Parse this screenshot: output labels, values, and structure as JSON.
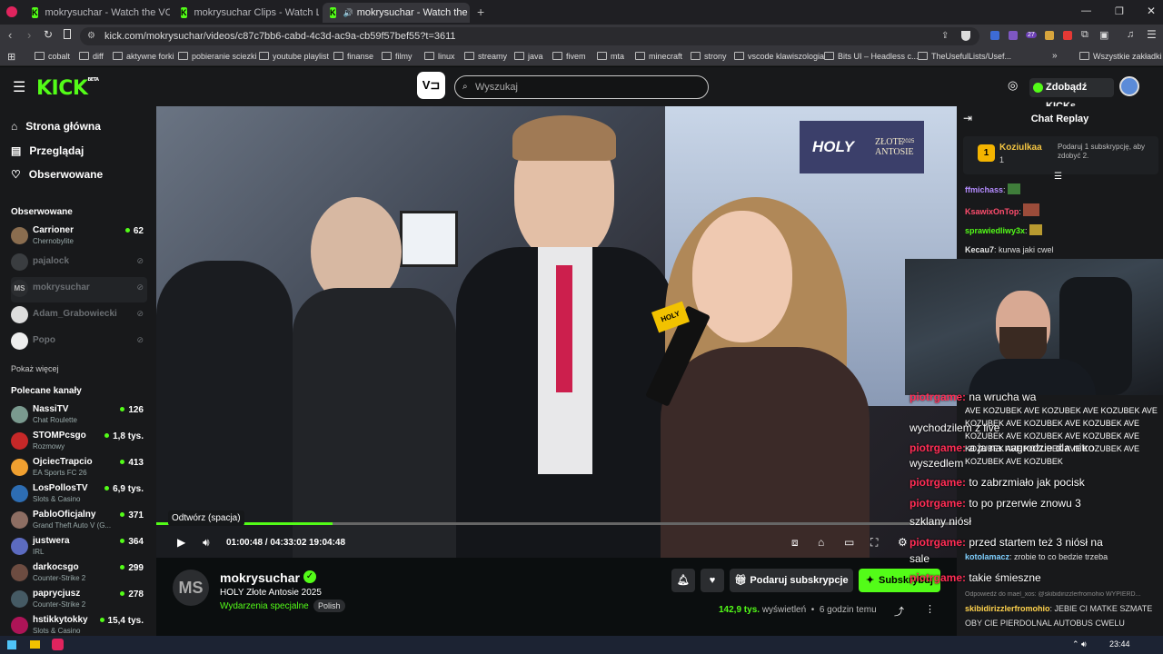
{
  "browser": {
    "tabs": [
      {
        "title": "mokrysuchar - Watch the VOD on Ki",
        "active": false
      },
      {
        "title": "mokrysuchar Clips - Watch Live on Ki",
        "active": false
      },
      {
        "title": "mokrysuchar - Watch the VO",
        "active": true
      }
    ],
    "url": "kick.com/mokrysuchar/videos/c87c7bb6-cabd-4c3d-ac9a-cb59f57bef55?t=3611",
    "ext_badge": "27",
    "bookmarks": [
      "cobalt",
      "diff",
      "aktywne forki",
      "pobieranie sciezki",
      "youtube playlist",
      "finanse",
      "filmy",
      "linux",
      "streamy",
      "java",
      "fivem",
      "mta",
      "minecraft",
      "strony",
      "vscode klawiszologia",
      "Bits UI – Headless c...",
      "TheUsefulLists/Usef..."
    ],
    "bookmarks_all": "Wszystkie zakładki"
  },
  "header": {
    "logo": "KICK",
    "logo_badge": "BETA",
    "search_placeholder": "Wyszukaj",
    "get_kicks": "Zdobądź KICKs"
  },
  "sidebar": {
    "nav": [
      "Strona główna",
      "Przeglądaj",
      "Obserwowane"
    ],
    "followed_title": "Obserwowane",
    "followed": [
      {
        "name": "Carrioner",
        "category": "Chernobylite",
        "count": "62",
        "online": true
      },
      {
        "name": "pajalock",
        "online": false
      },
      {
        "name": "mokrysuchar",
        "online": false,
        "selected": true,
        "initials": "MS"
      },
      {
        "name": "Adam_Grabowiecki",
        "online": false
      },
      {
        "name": "Popo",
        "online": false
      }
    ],
    "show_more": "Pokaż więcej",
    "recommended_title": "Polecane kanały",
    "recommended": [
      {
        "name": "NassiTV",
        "category": "Chat Roulette",
        "count": "126"
      },
      {
        "name": "STOMPcsgo",
        "category": "Rozmowy",
        "count": "1,8 tys."
      },
      {
        "name": "OjciecTrapcio",
        "category": "EA Sports FC 26",
        "count": "413"
      },
      {
        "name": "LosPollosTV",
        "category": "Slots & Casino",
        "count": "6,9 tys."
      },
      {
        "name": "PabloOficjalny",
        "category": "Grand Theft Auto V (G...",
        "count": "371"
      },
      {
        "name": "justwera",
        "category": "IRL",
        "count": "364"
      },
      {
        "name": "darkocsgo",
        "category": "Counter-Strike 2",
        "count": "299"
      },
      {
        "name": "paprycjusz",
        "category": "Counter-Strike 2",
        "count": "278"
      },
      {
        "name": "hstikkytokky",
        "category": "Slots & Casino",
        "count": "15,4 tys."
      }
    ]
  },
  "video": {
    "banner_holy": "HOLY",
    "banner_text": "ZŁOTE ANTOSIE",
    "banner_year": "2025",
    "mic_label": "HOLY",
    "tooltip": "Odtwórz (spacja)",
    "time_current": "01:00:48",
    "time_total": "04:33:02",
    "clock": "19:04:48",
    "progress": 0.22
  },
  "info": {
    "initials": "MS",
    "channel": "mokrysuchar",
    "title": "HOLY Złote Antosie 2025",
    "category": "Wydarzenia specjalne",
    "language": "Polish",
    "gift_sub": "Podaruj subskrypcje",
    "subscribe": "Subskrybuj",
    "views_count": "142,9 tys.",
    "views_label": "wyświetleń",
    "ago": "6 godzin temu"
  },
  "chat": {
    "title": "Chat Replay",
    "gifter_name": "Koziulkaa",
    "gifter_count": "1",
    "gifter_text": "Podaruj 1 subskrypcję, aby zdobyć 2.",
    "messages": [
      {
        "user": "ffmichass",
        "color": "#b58cff",
        "text": ""
      },
      {
        "user": "KsawixOnTop",
        "color": "#ff4d6d",
        "text": ""
      },
      {
        "user": "sprawiedliwy3x",
        "color": "#53fc18",
        "text": ""
      },
      {
        "user": "Kecau7",
        "color": "#e6e6e6",
        "text": "kurwa jaki cwel"
      },
      {
        "user": "kotolamacz",
        "color": "#7fd0ff",
        "text": "zrobie to co bedzie trzeba"
      },
      {
        "user": "skibidirizzlerfromohio",
        "color": "#ffd34d",
        "text": "JEBIE CI MATKE SZMATE"
      },
      {
        "user": "",
        "color": "#ddd",
        "text": "OBY CIE PIERDOLNAL AUTOBUS CWELU"
      }
    ],
    "reply_note": "Odpowiedź do mael_xos: @skibidirizzlerfromohio WYPIERD...",
    "overlay": [
      {
        "user": "piotrgame:",
        "text": "na wrucha wa"
      },
      {
        "user": "",
        "text": "wychodzilem z live"
      },
      {
        "user": "piotrgame:",
        "text": "a ja na nagrodzie dla nitro"
      },
      {
        "user": "",
        "text": "wyszedlem"
      },
      {
        "user": "piotrgame:",
        "text": "to zabrzmiało jak pocisk"
      },
      {
        "user": "piotrgame:",
        "text": "to po przerwie znowu 3"
      },
      {
        "user": "",
        "text": "szklany niósł"
      },
      {
        "user": "piotrgame:",
        "text": "przed startem też 3 niósł na"
      },
      {
        "user": "",
        "text": "sale"
      },
      {
        "user": "piotrgame:",
        "text": "takie śmieszne"
      }
    ],
    "emote_spam": "AVE KOZUBEK"
  },
  "taskbar": {
    "time": "23:44"
  },
  "colors": {
    "accent": "#53fc18",
    "bg": "#0b0e0f",
    "panel": "#18191b"
  }
}
